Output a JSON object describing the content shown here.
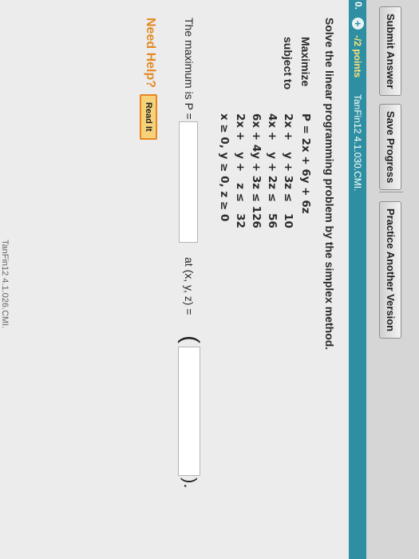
{
  "toolbar": {
    "submit_label": "Submit Answer",
    "save_label": "Save Progress",
    "practice_label": "Practice Another Version"
  },
  "question": {
    "number": "0.",
    "expand_symbol": "+",
    "points": "-/2 points",
    "id": "TanFin12 4.1.030.CMI.",
    "prompt": "Solve the linear programming problem by the simplex method.",
    "maximize_label": "Maximize",
    "objective": "P = 2x + 6y + 6z",
    "subject_label": "subject to",
    "constraints": [
      "2x +   y + 3z ≤   10",
      "4x +   y + 2z ≤   56",
      "6x + 4y + 3z ≤ 126",
      "2x +   y +   z ≤   32"
    ],
    "nonneg": "x ≥ 0, y ≥ 0, z ≥ 0",
    "answer_prefix": "The maximum is P =",
    "at_label": "at (x, y, z) =",
    "close_paren": ").",
    "max_value": "",
    "point_value": ""
  },
  "help": {
    "need_help_label": "Need Help?",
    "read_it_label": "Read It"
  },
  "footer": {
    "cut_text": "TanFin12 4.1.026.CMI."
  },
  "colors": {
    "question_bar": "#2f8fa2",
    "points_text": "#ffe27a",
    "need_help": "#e38a24",
    "read_it_bg": "#f6d37a",
    "read_it_border": "#e6871f"
  }
}
